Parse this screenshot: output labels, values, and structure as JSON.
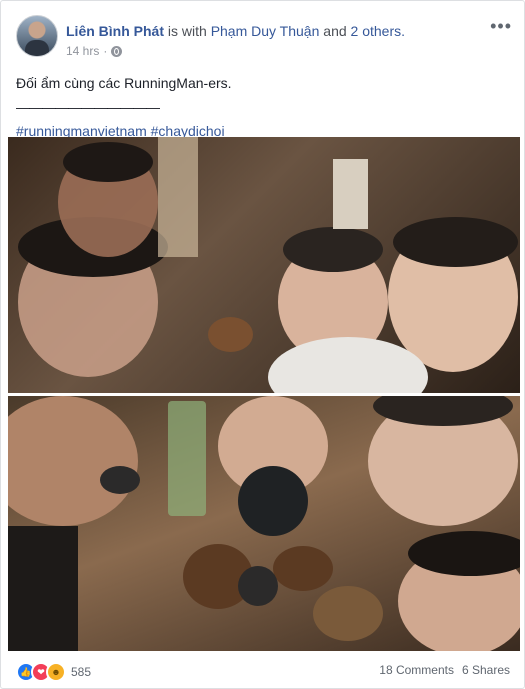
{
  "post": {
    "author": "Liên Bình Phát",
    "with_text": "is with",
    "tagged_person": "Phạm Duy Thuận",
    "and_text": "and",
    "others": "2 others.",
    "timestamp": "14 hrs",
    "privacy_icon": "globe-icon",
    "more_icon": "more-options-icon",
    "text_line1": "Đối ẩm cùng các RunningMan-ers.",
    "text_divider": "———————————",
    "hashtag1": "#runningmanvietnam",
    "hashtag2": "#chaydichoi"
  },
  "photos": [
    {
      "alt": "photo-1"
    },
    {
      "alt": "photo-2"
    }
  ],
  "footer": {
    "reaction_icons": [
      "like-icon",
      "love-icon",
      "haha-icon"
    ],
    "reaction_count": "585",
    "comments": "18 Comments",
    "shares": "6 Shares"
  },
  "colors": {
    "link": "#365899",
    "like": "#2078f4",
    "love": "#f33e58",
    "haha": "#f7b125"
  }
}
